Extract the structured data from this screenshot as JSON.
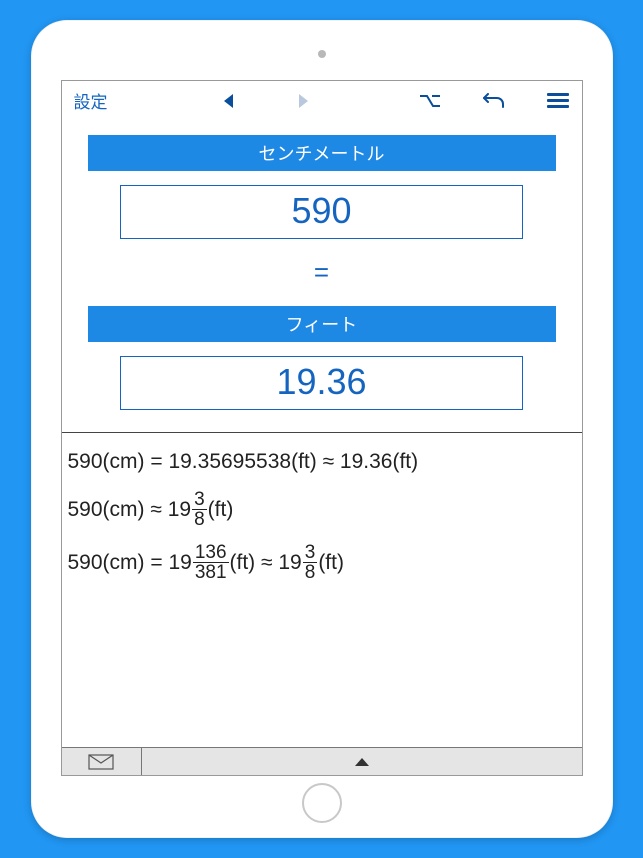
{
  "toolbar": {
    "settings_label": "設定"
  },
  "conversion": {
    "from_label": "センチメートル",
    "from_value": "590",
    "equals": "=",
    "to_label": "フィート",
    "to_value": "19.36"
  },
  "results": {
    "line1": {
      "lhs": "590(cm) = 19.35695538(ft) ≈ 19.36(ft)"
    },
    "line2": {
      "prefix": "590(cm) ≈ 19",
      "frac_num": "3",
      "frac_den": "8",
      "suffix": "(ft)"
    },
    "line3": {
      "prefix": "590(cm) = 19",
      "frac1_num": "136",
      "frac1_den": "381",
      "mid": "(ft) ≈ 19",
      "frac2_num": "3",
      "frac2_den": "8",
      "suffix": "(ft)"
    }
  }
}
